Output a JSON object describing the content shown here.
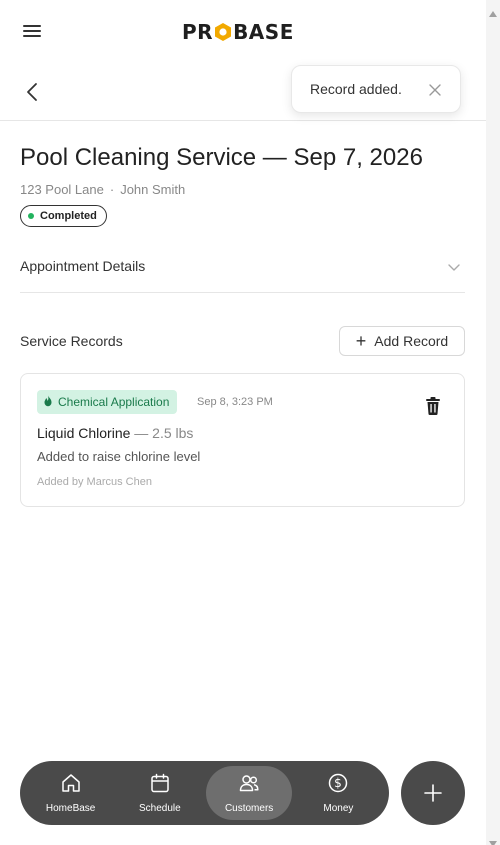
{
  "header": {
    "logo_pre": "PR",
    "logo_post": "BASE",
    "menu_icon": "hamburger-menu-icon",
    "back_icon": "chevron-left-icon"
  },
  "toast": {
    "message": "Record added.",
    "close_icon": "close-icon"
  },
  "appointment": {
    "title": "Pool Cleaning Service — Sep 7, 2026",
    "address": "123 Pool Lane",
    "separator": "·",
    "customer": "John Smith",
    "status": "Completed",
    "status_color": "#22b35e"
  },
  "details": {
    "label": "Appointment Details",
    "icon": "chevron-down-icon"
  },
  "service_records": {
    "title": "Service Records",
    "add_label": "Add Record",
    "records": [
      {
        "type": "Chemical Application",
        "type_icon": "flame-icon",
        "timestamp": "Sep 8, 3:23 PM",
        "product": "Liquid Chlorine",
        "amount": "— 2.5 lbs",
        "note": "Added to raise chlorine level",
        "added_by": "Added by Marcus Chen"
      }
    ]
  },
  "nav": {
    "items": [
      {
        "label": "HomeBase",
        "icon": "home-icon"
      },
      {
        "label": "Schedule",
        "icon": "calendar-icon"
      },
      {
        "label": "Customers",
        "icon": "users-icon",
        "active": true
      },
      {
        "label": "Money",
        "icon": "dollar-icon"
      }
    ],
    "fab_icon": "plus-icon"
  },
  "colors": {
    "accent": "#f2a900",
    "chip_bg": "#d3f2e3",
    "chip_text": "#1a7a4b",
    "nav_bg": "#4a4a4a"
  }
}
